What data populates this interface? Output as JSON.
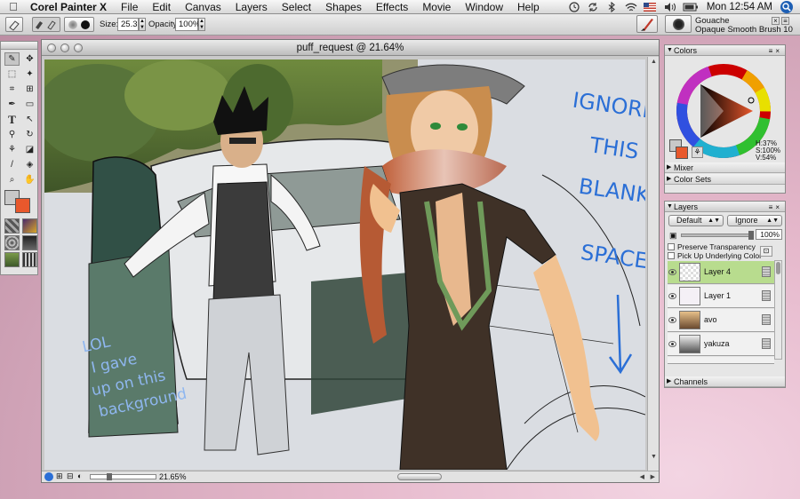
{
  "menubar": {
    "app_name": "Corel Painter X",
    "items": [
      "File",
      "Edit",
      "Canvas",
      "Layers",
      "Select",
      "Shapes",
      "Effects",
      "Movie",
      "Window",
      "Help"
    ],
    "clock": "Mon 12:54 AM"
  },
  "property_bar": {
    "size_label": "Size:",
    "size_value": "25.3",
    "opacity_label": "Opacity:",
    "opacity_value": "100%",
    "brush_category": "Gouache",
    "brush_variant": "Opaque Smooth Brush 10"
  },
  "document": {
    "title": "puff_request @ 21.64%",
    "zoom_readout": "21.65%",
    "handwritten_right": "IGNORE THIS BLANK SPACE",
    "handwritten_left": "LOL I gave up on this background"
  },
  "colors_panel": {
    "title": "Colors",
    "h": "H:37%",
    "s": "S:100%",
    "v": "V:54%",
    "main_color": "#e8582c",
    "additional_color": "#c8c8c8"
  },
  "mixer_panel": {
    "title": "Mixer"
  },
  "colorsets_panel": {
    "title": "Color Sets"
  },
  "layers_panel": {
    "title": "Layers",
    "composite_method": "Default",
    "depth_method": "Ignore",
    "opacity": "100%",
    "preserve_transparency": "Preserve Transparency",
    "pick_up_underlying": "Pick Up Underlying Color",
    "layers": [
      {
        "name": "Layer 4",
        "selected": true
      },
      {
        "name": "Layer 1",
        "selected": false
      },
      {
        "name": "avo",
        "selected": false
      },
      {
        "name": "yakuza",
        "selected": false
      }
    ]
  },
  "channels_panel": {
    "title": "Channels"
  },
  "icons": [
    "apple-icon",
    "time-machine-icon",
    "sync-icon",
    "bluetooth-icon",
    "wifi-icon",
    "flag-icon",
    "volume-icon",
    "battery-icon",
    "spotlight-icon"
  ]
}
